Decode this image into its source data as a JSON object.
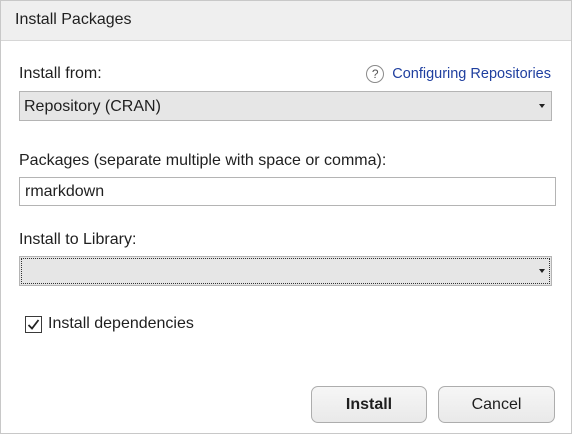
{
  "dialog": {
    "title": "Install Packages"
  },
  "install_from": {
    "label": "Install from:",
    "selected": "Repository (CRAN)"
  },
  "help": {
    "icon": "?",
    "link_text": "Configuring Repositories"
  },
  "packages": {
    "label": "Packages (separate multiple with space or comma):",
    "value": "rmarkdown"
  },
  "library": {
    "label": "Install to Library:",
    "selected": ""
  },
  "dependencies": {
    "label": "Install dependencies",
    "checked": true
  },
  "buttons": {
    "install": "Install",
    "cancel": "Cancel"
  }
}
